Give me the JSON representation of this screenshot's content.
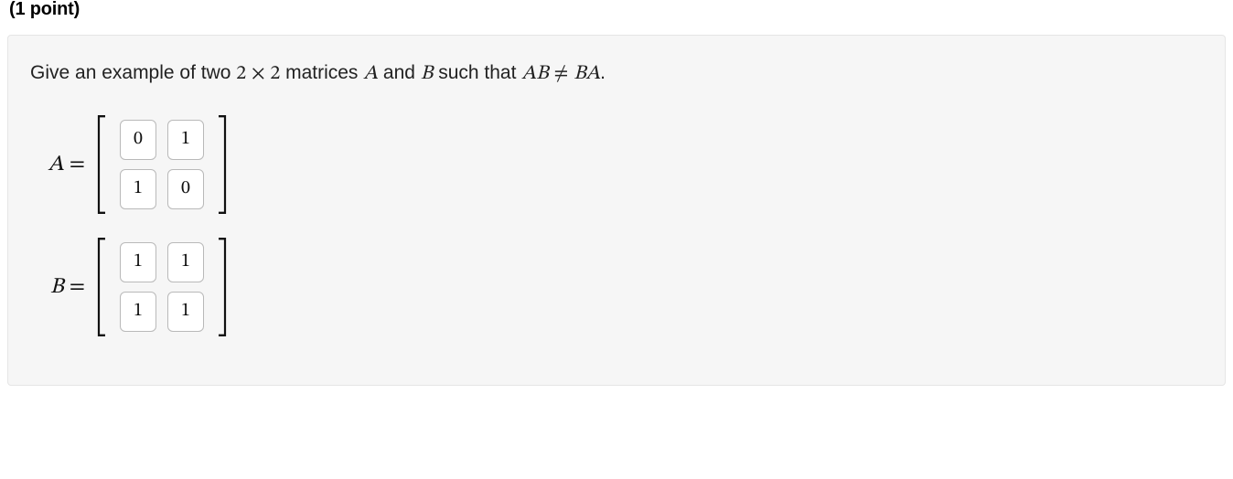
{
  "header": {
    "points_label": "(1 point)"
  },
  "prompt": {
    "prefix": "Give an example of two ",
    "dim": "2 × 2",
    "mid1": " matrices ",
    "A": "A",
    "mid2": " and ",
    "B": "B",
    "mid3": " such that ",
    "AB": "AB",
    "neq": "≠",
    "BA": "BA",
    "suffix": "."
  },
  "matrices": {
    "A": {
      "label": "A",
      "eq": "=",
      "cells": [
        [
          "0",
          "1"
        ],
        [
          "1",
          "0"
        ]
      ]
    },
    "B": {
      "label": "B",
      "eq": "=",
      "cells": [
        [
          "1",
          "1"
        ],
        [
          "1",
          "1"
        ]
      ]
    }
  }
}
